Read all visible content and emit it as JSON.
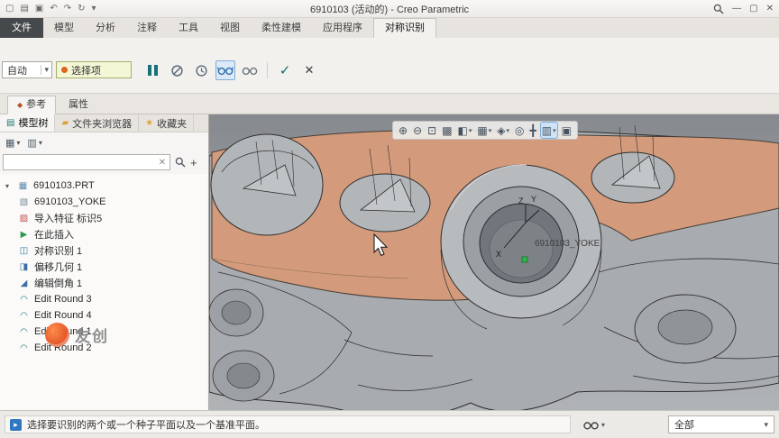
{
  "icons": {
    "caret": "▾",
    "new_file": "▢",
    "open_file": "▤",
    "save": "▣",
    "undo": "↶",
    "redo": "↷",
    "regenerate": "↻",
    "minimize": "—",
    "maximize": "▢",
    "close": "✕",
    "check": "✓",
    "cancel": "✕",
    "clear": "✕",
    "plus": "+",
    "prompt": "▸",
    "ref_tab": "◆",
    "tree_tab": "▤",
    "folder_tab": "▰",
    "star_tab": "★",
    "tree_settings": "▦",
    "show_settings": "▥",
    "part": "▦",
    "body": "▧",
    "import_feature": "▨",
    "insert_here": "▶",
    "symmetry": "◫",
    "offset": "◨",
    "chamfer": "◢",
    "round": "◠",
    "zoom_in": "⊕",
    "zoom_out": "⊖",
    "refit": "⊡",
    "repaint": "▩",
    "display_style": "◧",
    "saved_views": "▦",
    "datum_display": "◈",
    "annotation": "◎",
    "spin_center": "╋",
    "graphics_toolbar": "▥",
    "more": "▣"
  },
  "titlebar": {
    "title": "6910103 (活动的) - Creo Parametric",
    "quick_access": [
      {
        "name": "new-file-button",
        "icon": "new_file"
      },
      {
        "name": "open-file-button",
        "icon": "open_file"
      },
      {
        "name": "save-button",
        "icon": "save"
      },
      {
        "name": "undo-button",
        "icon": "undo"
      },
      {
        "name": "redo-button",
        "icon": "redo"
      },
      {
        "name": "regenerate-button",
        "icon": "regenerate"
      },
      {
        "name": "quick-access-customize-button",
        "icon": "caret"
      }
    ]
  },
  "ribbon": {
    "tabs": [
      {
        "label": "文件",
        "file": true
      },
      {
        "label": "模型"
      },
      {
        "label": "分析"
      },
      {
        "label": "注释"
      },
      {
        "label": "工具"
      },
      {
        "label": "视图"
      },
      {
        "label": "柔性建模"
      },
      {
        "label": "应用程序"
      },
      {
        "label": "对称识别",
        "active": true
      }
    ],
    "dashboard": {
      "direction_dropdown": "自动",
      "collector_label": "选择项"
    }
  },
  "subtabs": {
    "references": "参考",
    "properties": "属性"
  },
  "panel": {
    "tabs": [
      {
        "label": "模型树",
        "icon": "tree_tab",
        "active": true
      },
      {
        "label": "文件夹浏览器",
        "icon": "folder_tab"
      },
      {
        "label": "收藏夹",
        "icon": "star_tab"
      }
    ],
    "search_value": "",
    "tree_items": [
      {
        "label": "6910103.PRT",
        "icon": "part",
        "indent": 0,
        "caret": true
      },
      {
        "label": "6910103_YOKE",
        "icon": "body",
        "indent": 1
      },
      {
        "label": "导入特征 标识5",
        "icon": "import_feature",
        "indent": 1
      },
      {
        "label": "在此插入",
        "icon": "insert_here",
        "indent": 1
      },
      {
        "label": "对称识别 1",
        "icon": "symmetry",
        "indent": 1
      },
      {
        "label": "偏移几何 1",
        "icon": "offset",
        "indent": 1
      },
      {
        "label": "编辑倒角 1",
        "icon": "chamfer",
        "indent": 1
      },
      {
        "label": "Edit Round 3",
        "icon": "round",
        "indent": 1
      },
      {
        "label": "Edit Round 4",
        "icon": "round",
        "indent": 1
      },
      {
        "label": "Edit Round 1",
        "icon": "round",
        "indent": 1
      },
      {
        "label": "Edit Round 2",
        "icon": "round",
        "indent": 1
      }
    ]
  },
  "viewport": {
    "toolbar": [
      {
        "name": "zoom-in-button",
        "icon": "zoom_in"
      },
      {
        "name": "zoom-out-button",
        "icon": "zoom_out"
      },
      {
        "name": "refit-button",
        "icon": "refit"
      },
      {
        "name": "repaint-button",
        "icon": "repaint"
      },
      {
        "name": "display-style-button",
        "icon": "display_style",
        "caret": true
      },
      {
        "name": "saved-views-button",
        "icon": "saved_views",
        "caret": true
      },
      {
        "name": "datum-display-button",
        "icon": "datum_display",
        "caret": true
      },
      {
        "name": "annotation-display-button",
        "icon": "annotation"
      },
      {
        "name": "spin-center-button",
        "icon": "spin_center"
      },
      {
        "name": "graphics-toolbar-button",
        "icon": "graphics_toolbar",
        "caret": true,
        "active": true
      },
      {
        "name": "more-button",
        "icon": "more"
      }
    ],
    "csys_label": "6910103_YOKE",
    "axes": {
      "x": "X",
      "y": "Y",
      "z": "Z"
    },
    "colors": {
      "highlight_face": "#d39b7c",
      "body_gray": "#a8acb0",
      "hole_gray": "#70767b",
      "background_top": "#868a8e",
      "background_bottom": "#b0b3b6"
    }
  },
  "watermark": {
    "text": "友创"
  },
  "statusbar": {
    "message": "选择要识别的两个或一个种子平面以及一个基准平面。",
    "filter_label": "全部"
  }
}
